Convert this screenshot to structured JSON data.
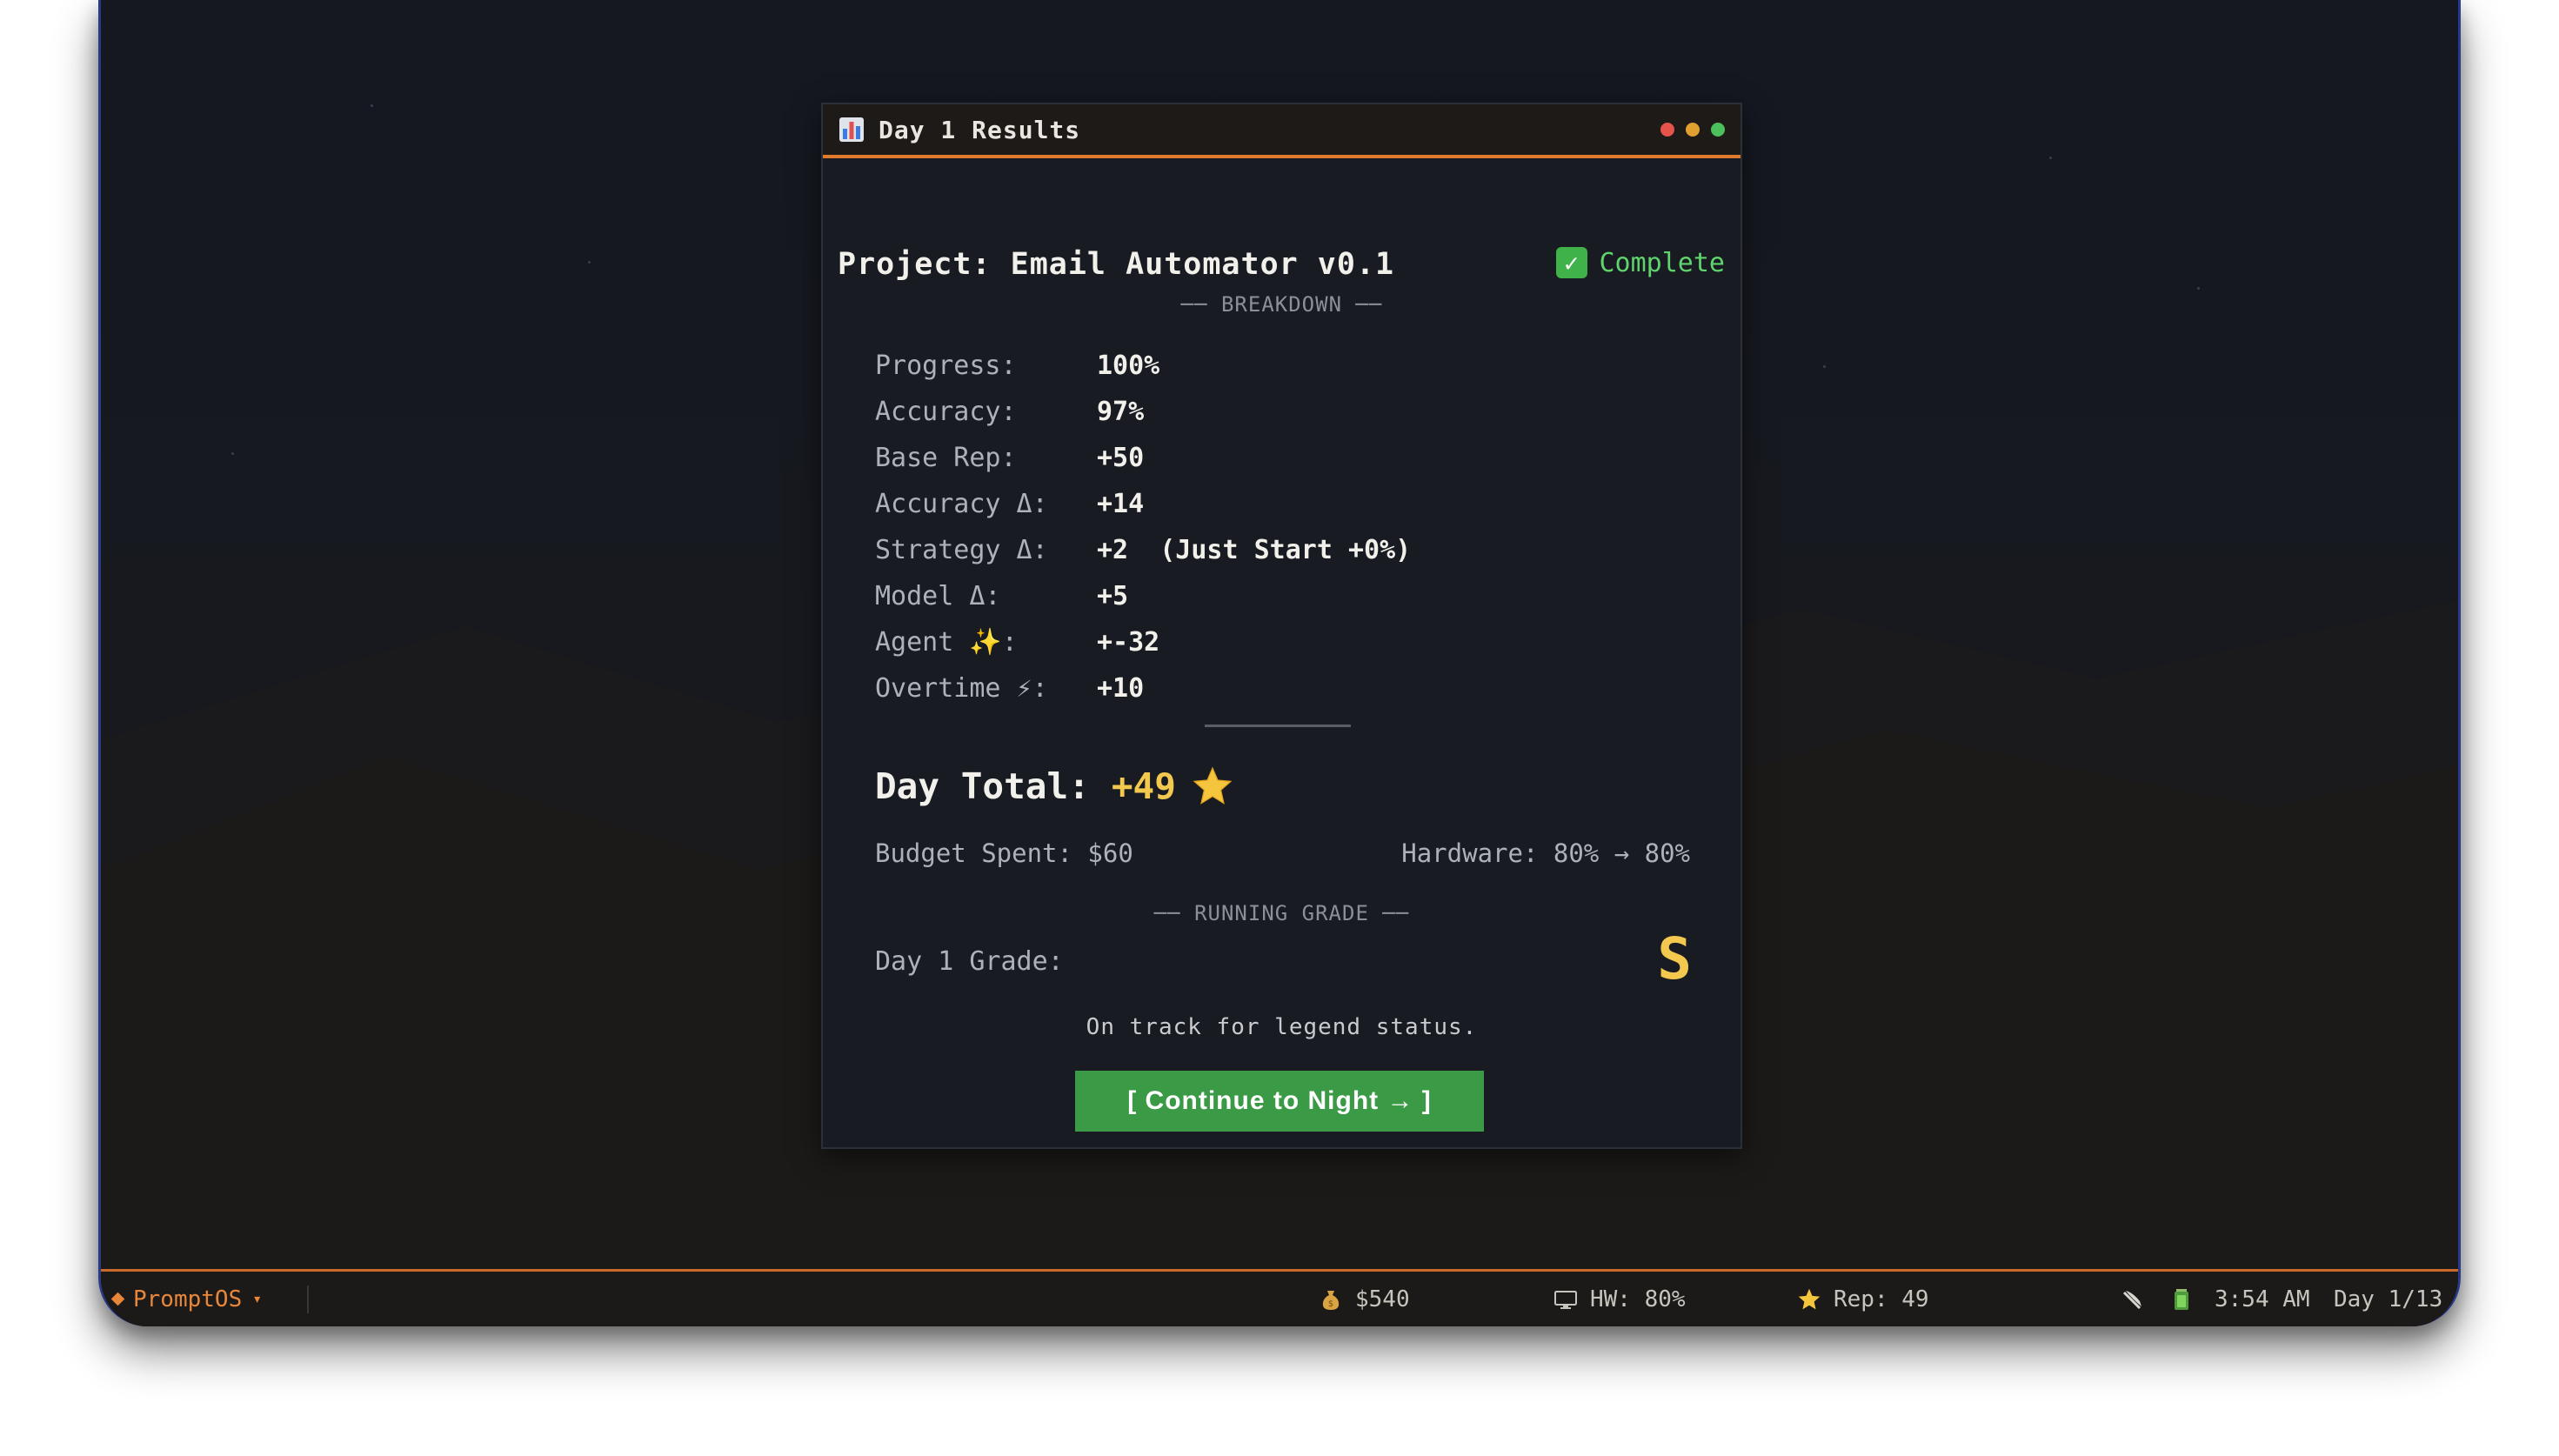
{
  "window": {
    "title": "Day 1 Results",
    "title_icon": "bar-chart-icon",
    "controls_colors": [
      "#e5534b",
      "#e0a030",
      "#4cc05a"
    ]
  },
  "project": {
    "title": "Project: Email Automator v0.1",
    "status_label": "Complete",
    "status_icon": "check-icon"
  },
  "breakdown": {
    "heading": "── BREAKDOWN ──",
    "rows": [
      {
        "label": "Progress:",
        "value": "100%"
      },
      {
        "label": "Accuracy:",
        "value": "97%"
      },
      {
        "label": "Base Rep:",
        "value": "+50"
      },
      {
        "label": "Accuracy Δ:",
        "value": "+14"
      },
      {
        "label": "Strategy Δ:",
        "value": "+2  (Just Start +0%)"
      },
      {
        "label": "Model Δ:",
        "value": "+5"
      },
      {
        "label": "Agent ✨:",
        "value": "+-32"
      },
      {
        "label": "Overtime ⚡:",
        "value": "+10"
      }
    ]
  },
  "day_total": {
    "label": "Day Total:",
    "value": "+49",
    "icon": "star-icon"
  },
  "budget": "Budget Spent: $60",
  "hardware": "Hardware: 80% → 80%",
  "running_grade": {
    "heading": "── RUNNING GRADE ──",
    "label": "Day 1 Grade:",
    "value": "S",
    "flavor": "On track for legend status."
  },
  "continue_button": "[ Continue to Night → ]",
  "taskbar": {
    "brand": "PromptOS",
    "money": "$540",
    "hardware": "HW: 80%",
    "reputation": "Rep: 49",
    "time": "3:54 AM",
    "day": "Day 1/13"
  },
  "colors": {
    "accent": "#e07b2e",
    "gold": "#f2c84f",
    "success": "#3a9a45"
  }
}
